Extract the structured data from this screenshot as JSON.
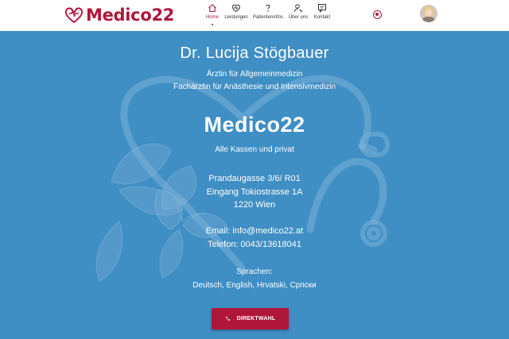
{
  "header": {
    "logo_text": "Medico22",
    "nav": [
      {
        "label": "Home",
        "icon": "home-icon",
        "active": true
      },
      {
        "label": "Leistungen",
        "icon": "heart-pulse-icon",
        "active": false
      },
      {
        "label": "Patienteninfos",
        "icon": "question-icon",
        "active": false
      },
      {
        "label": "Über uns",
        "icon": "user-key-icon",
        "active": false
      },
      {
        "label": "Kontakt",
        "icon": "chat-icon",
        "active": false
      }
    ],
    "language_icon": "language-toggle-icon",
    "avatar_icon": "profile-avatar"
  },
  "hero": {
    "doctor_name": "Dr. Lucija Stögbauer",
    "specialty_1": "Ärztin für Allgemeinmedizin",
    "specialty_2": "Fachärztin für Anästhesie und Intensivmedizin",
    "brand": "Medico22",
    "insurance": "Alle Kassen und privat",
    "address_line_1": "Prandaugasse 3/6/ R01",
    "address_line_2": "Eingang Tokiostrasse 1A",
    "address_line_3": "1220 Wien",
    "email": "Email: info@medico22.at",
    "phone": "Telefon: 0043/13618041",
    "languages_title": "Sprachen:",
    "languages": "Deutsch, English, Hrvatski, Српски",
    "cta_label": "DIREKTWAHL",
    "cta_icon": "phone-icon"
  },
  "colors": {
    "brand_red": "#b0163a",
    "hero_blue": "#3f8ec4"
  }
}
